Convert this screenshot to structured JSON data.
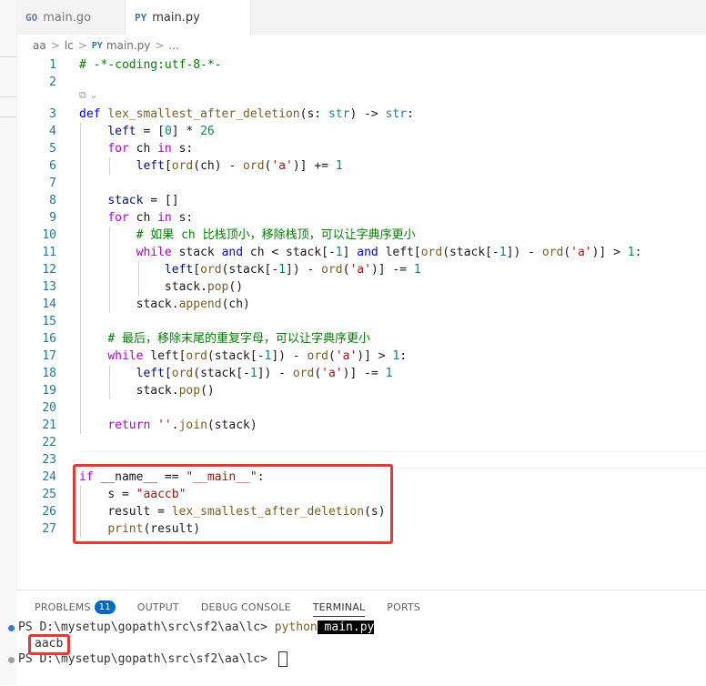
{
  "tabs": [
    {
      "icon": "go-file-icon",
      "icon_text": "GO",
      "label": "main.go"
    },
    {
      "icon": "python-file-icon",
      "icon_text": "PY",
      "label": "main.py"
    }
  ],
  "breadcrumb": {
    "parts": [
      "aa",
      "lc",
      "main.py",
      "..."
    ],
    "separator": ">"
  },
  "editor": {
    "codelens": "⧉ ⌄",
    "line_numbers": [
      "1",
      "2",
      "3",
      "4",
      "5",
      "6",
      "7",
      "8",
      "9",
      "10",
      "11",
      "12",
      "13",
      "14",
      "15",
      "16",
      "17",
      "18",
      "19",
      "20",
      "21",
      "22",
      "23",
      "24",
      "25",
      "26",
      "27"
    ]
  },
  "code": {
    "l1": "# -*-coding:utf-8-*-",
    "l3_def": "def",
    "l3_name": "lex_smallest_after_deletion",
    "l3_params": "(s: ",
    "l3_str1": "str",
    "l3_arrow": ") -> ",
    "l3_str2": "str",
    "l3_end": ":",
    "l4_a": "left",
    "l4_b": " = [",
    "l4_c": "0",
    "l4_d": "] * ",
    "l4_e": "26",
    "l5_a": "for",
    "l5_b": " ch ",
    "l5_c": "in",
    "l5_d": " s:",
    "l6_a": "left",
    "l6_b": "[",
    "l6_c": "ord",
    "l6_d": "(ch) - ",
    "l6_e": "ord",
    "l6_f": "(",
    "l6_g": "'a'",
    "l6_h": ")] += ",
    "l6_i": "1",
    "l8_a": "stack",
    "l8_b": " = []",
    "l9_a": "for",
    "l9_b": " ch ",
    "l9_c": "in",
    "l9_d": " s:",
    "l10": "# 如果 ch 比栈顶小，移除栈顶，可以让字典序更小",
    "l11_a": "while",
    "l11_b": " stack ",
    "l11_c": "and",
    "l11_d": " ch < stack[-",
    "l11_e": "1",
    "l11_f": "] ",
    "l11_g": "and",
    "l11_h": " left[",
    "l11_i": "ord",
    "l11_j": "(stack[-",
    "l11_k": "1",
    "l11_l": "]) - ",
    "l11_m": "ord",
    "l11_n": "(",
    "l11_o": "'a'",
    "l11_p": ")] > ",
    "l11_q": "1",
    "l11_r": ":",
    "l12_a": "left",
    "l12_b": "[",
    "l12_c": "ord",
    "l12_d": "(stack[-",
    "l12_e": "1",
    "l12_f": "]) - ",
    "l12_g": "ord",
    "l12_h": "(",
    "l12_i": "'a'",
    "l12_j": ")] -= ",
    "l12_k": "1",
    "l13_a": "stack.",
    "l13_b": "pop",
    "l13_c": "()",
    "l14_a": "stack.",
    "l14_b": "append",
    "l14_c": "(ch)",
    "l16": "# 最后，移除末尾的重复字母，可以让字典序更小",
    "l17_a": "while",
    "l17_b": " left[",
    "l17_c": "ord",
    "l17_d": "(stack[-",
    "l17_e": "1",
    "l17_f": "]) - ",
    "l17_g": "ord",
    "l17_h": "(",
    "l17_i": "'a'",
    "l17_j": ")] > ",
    "l17_k": "1",
    "l17_l": ":",
    "l18_a": "left",
    "l18_b": "[",
    "l18_c": "ord",
    "l18_d": "(stack[-",
    "l18_e": "1",
    "l18_f": "]) - ",
    "l18_g": "ord",
    "l18_h": "(",
    "l18_i": "'a'",
    "l18_j": ")] -= ",
    "l18_k": "1",
    "l19_a": "stack.",
    "l19_b": "pop",
    "l19_c": "()",
    "l21_a": "return",
    "l21_b": " ''",
    "l21_c": ".",
    "l21_d": "join",
    "l21_e": "(stack)",
    "l24_a": "if",
    "l24_b": " __name__ == ",
    "l24_c": "\"__main__\"",
    "l24_d": ":",
    "l25_a": "s = ",
    "l25_b": "\"aaccb\"",
    "l26_a": "result = ",
    "l26_b": "lex_smallest_after_deletion",
    "l26_c": "(s)",
    "l27_a": "print",
    "l27_b": "(result)"
  },
  "panel": {
    "tabs": [
      "PROBLEMS",
      "OUTPUT",
      "DEBUG CONSOLE",
      "TERMINAL",
      "PORTS"
    ],
    "problems_count": "11",
    "active_tab": "TERMINAL"
  },
  "terminal": {
    "line1_prompt": "PS D:\\mysetup\\gopath\\src\\sf2\\aa\\lc> ",
    "line1_cmd": "python",
    "line1_arg": " main.py",
    "line2_output": "aacb",
    "line3_prompt": "PS D:\\mysetup\\gopath\\src\\sf2\\aa\\lc> "
  },
  "colors": {
    "keyword": "#af00db",
    "def_keyword": "#0000ff",
    "function": "#795e26",
    "comment": "#008000",
    "string": "#a31515",
    "number": "#098658",
    "line_number": "#237893",
    "highlight_box": "#e53935",
    "badge": "#0069c2"
  }
}
